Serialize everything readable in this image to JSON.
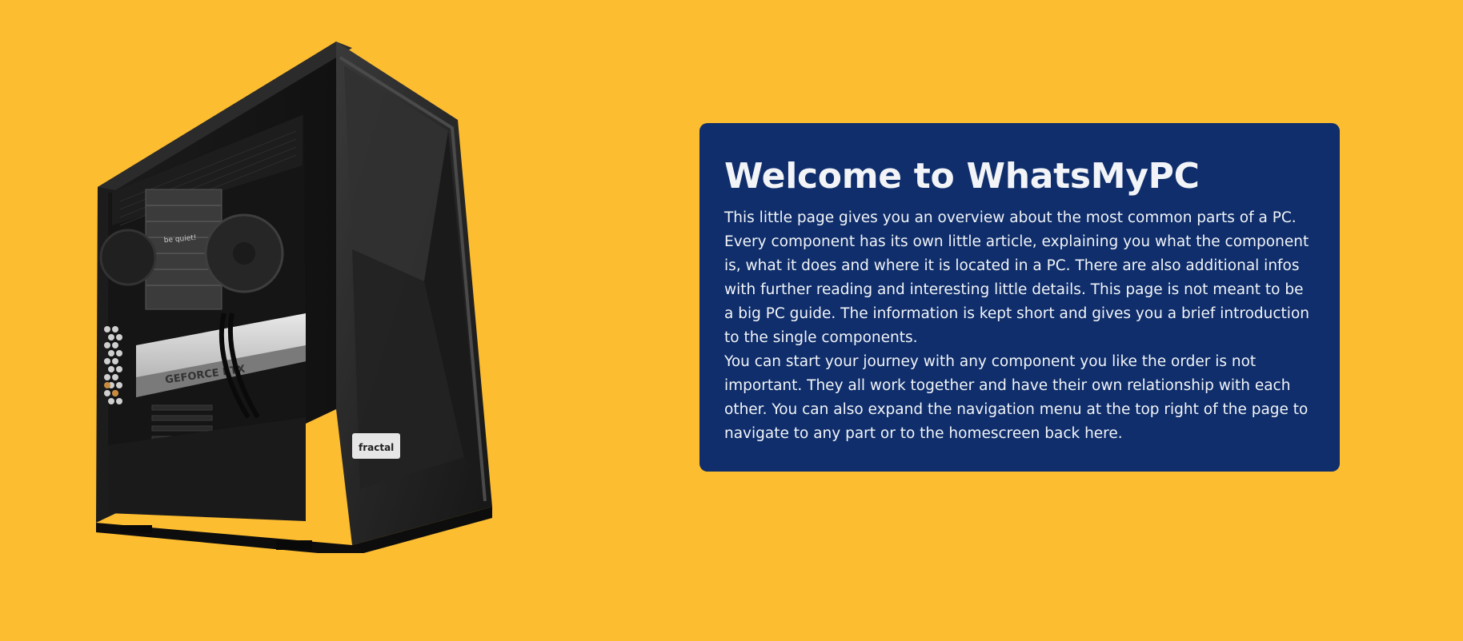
{
  "page": {
    "background_color": "#fdbd31"
  },
  "hero_image": {
    "description_icon": "pc-case-image",
    "case_brand_badge": "fractal",
    "gpu_label": "GEFORCE RTX",
    "cooler_label": "be quiet!"
  },
  "welcome": {
    "title": "Welcome to WhatsMyPC",
    "card_color": "#0f2e6b",
    "paragraph_1": "This little page gives you an overview about the most common parts of a PC. Every component has its own little article, explaining you what the component is, what it does and where it is located in a PC. There are also additional infos with further reading and interesting little details. This page is not meant to be a big PC guide. The information is kept short and gives you a brief introduction to the single components.",
    "paragraph_2": "You can start your journey with any component you like the order is not important. They all work together and have their own relationship with each other. You can also expand the navigation menu at the top right of the page to navigate to any part or to the homescreen back here."
  }
}
